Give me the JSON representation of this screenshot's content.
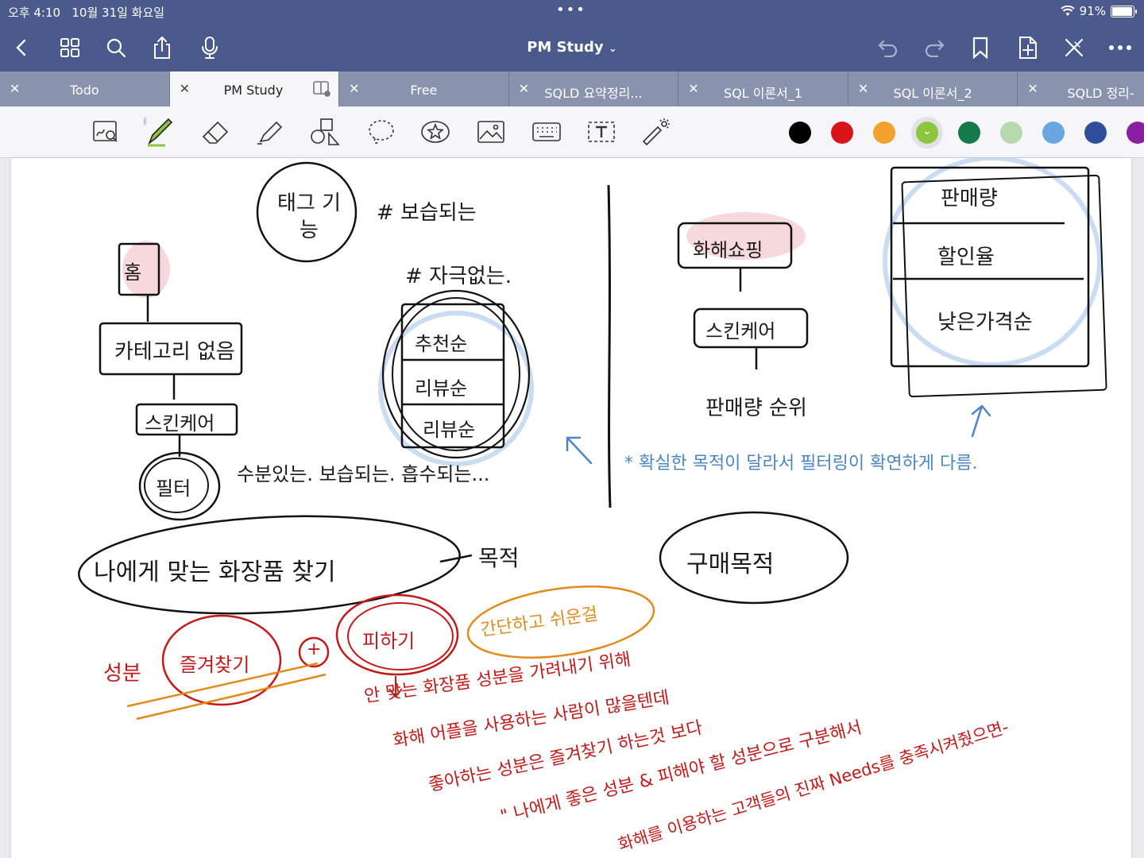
{
  "status": {
    "time": "오후 4:10",
    "date": "10월 31일 화요일",
    "battery": "91%"
  },
  "nav": {
    "title": "PM Study"
  },
  "tabs": [
    {
      "label": "Todo"
    },
    {
      "label": "PM Study"
    },
    {
      "label": "Free"
    },
    {
      "label": "SQLD 요약정리..."
    },
    {
      "label": "SQL 이론서_1"
    },
    {
      "label": "SQL 이론서_2"
    },
    {
      "label": "SQLD 정리-"
    }
  ],
  "colors": [
    "#000000",
    "#d8141a",
    "#f4a02c",
    "#8cc63e",
    "#157a4a",
    "#b7d9b0",
    "#6aa6e0",
    "#2f4f9c",
    "#8b1fa3"
  ],
  "notes": {
    "tag_label": "태그 기능",
    "hash1": "# 보습되는",
    "hash2": "# 자극없는.",
    "home": "홈",
    "category": "카테고리 없음",
    "skincare1": "스킨케어",
    "filter": "필터",
    "filter_desc": "수분있는. 보습되는. 흡수되는...",
    "sort1": "추천순",
    "sort2": "리뷰순",
    "sort3": "리뷰순",
    "find_cosmetics": "나에게 맞는 화장품 찾기",
    "goal": "목적",
    "buy_goal": "구매목적",
    "ingredient": "성분",
    "favorite": "즐겨찾기",
    "avoid": "피하기",
    "simple": "간단하고 쉬운걸",
    "cosmetic_shop": "화해쇼핑",
    "skincare2": "스킨케어",
    "sales_rank": "판매량 순위",
    "r_sales": "판매량",
    "r_discount": "할인율",
    "r_lowprice": "낮은가격순",
    "blue_note": "* 확실한 목적이 달라서 필터링이 확연하게 다름.",
    "red1": "안 맞는 화장품 성분을 가려내기 위해",
    "red2": "화해 어플을 사용하는 사람이 많을텐데",
    "red3": "좋아하는 성분은 즐겨찾기 하는것 보다",
    "red4": "\" 나에게 좋은 성분 & 피해야 할 성분으로 구분해서",
    "red5": "화해를 이용하는 고객들의 진짜 Needs를 충족시켜줬으면-"
  }
}
